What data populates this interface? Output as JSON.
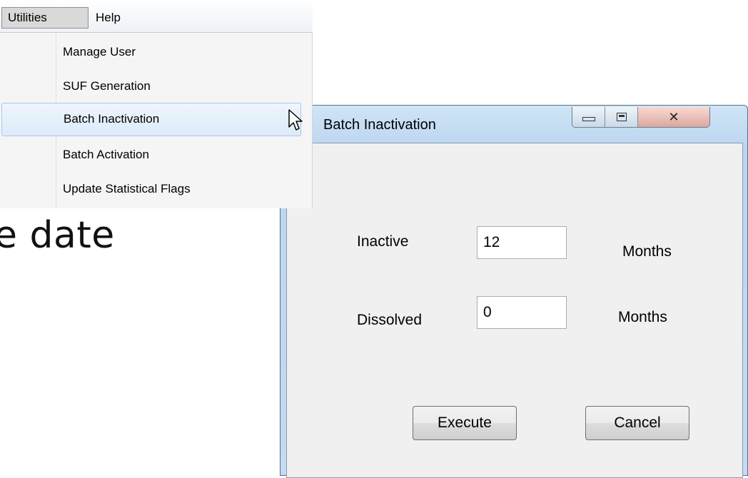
{
  "background": {
    "text": "e date"
  },
  "menubar": {
    "items": [
      {
        "label": "Utilities"
      },
      {
        "label": "Help"
      }
    ]
  },
  "dropdown": {
    "items": [
      {
        "label": "Manage User"
      },
      {
        "label": "SUF Generation"
      },
      {
        "label": "Batch Inactivation",
        "highlighted": true
      },
      {
        "label": "Batch Activation"
      },
      {
        "label": "Update Statistical Flags"
      }
    ]
  },
  "dialog": {
    "title": "Batch Inactivation",
    "controls": {
      "minimize_icon": "minimize-icon",
      "maximize_icon": "maximize-icon",
      "close_icon": "close-icon"
    },
    "fields": {
      "inactive": {
        "label": "Inactive",
        "value": "12",
        "unit": "Months"
      },
      "dissolved": {
        "label": "Dissolved",
        "value": "0",
        "unit": "Months"
      }
    },
    "buttons": {
      "execute": "Execute",
      "cancel": "Cancel"
    }
  },
  "colors": {
    "highlight": "#dcebfa",
    "title_bar": "#c4dbf1",
    "client": "#f0f0f0"
  }
}
